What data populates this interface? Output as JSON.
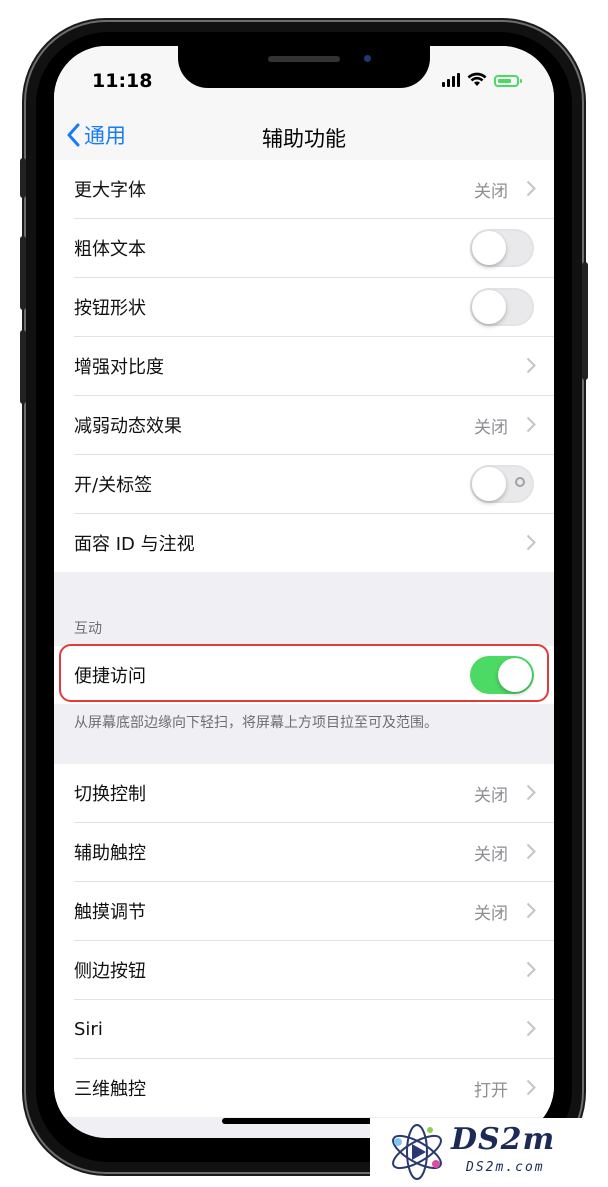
{
  "status_bar": {
    "time": "11:18"
  },
  "nav": {
    "back_label": "通用",
    "title": "辅助功能"
  },
  "top_group": [
    {
      "label": "更大字体",
      "value": "关闭",
      "control": "chevron"
    },
    {
      "label": "粗体文本",
      "control": "toggle",
      "on": false
    },
    {
      "label": "按钮形状",
      "control": "toggle",
      "on": false
    },
    {
      "label": "增强对比度",
      "control": "chevron"
    },
    {
      "label": "减弱动态效果",
      "value": "关闭",
      "control": "chevron"
    },
    {
      "label": "开/关标签",
      "control": "toggle",
      "on": false,
      "labels": true
    },
    {
      "label": "面容 ID 与注视",
      "control": "chevron"
    }
  ],
  "interaction": {
    "header": "互动",
    "reachability": {
      "label": "便捷访问",
      "on": true
    },
    "footer": "从屏幕底部边缘向下轻扫，将屏幕上方项目拉至可及范围。"
  },
  "bottom_group": [
    {
      "label": "切换控制",
      "value": "关闭"
    },
    {
      "label": "辅助触控",
      "value": "关闭"
    },
    {
      "label": "触摸调节",
      "value": "关闭"
    },
    {
      "label": "侧边按钮",
      "value": ""
    },
    {
      "label": "Siri",
      "value": ""
    },
    {
      "label": "三维触控",
      "value": "打开"
    }
  ],
  "watermark": {
    "title": "DS2m",
    "subtitle": "DS2m.com"
  },
  "colors": {
    "accent": "#1a7cf5",
    "toggle_on": "#4cd964",
    "highlight": "#e23b3b"
  }
}
